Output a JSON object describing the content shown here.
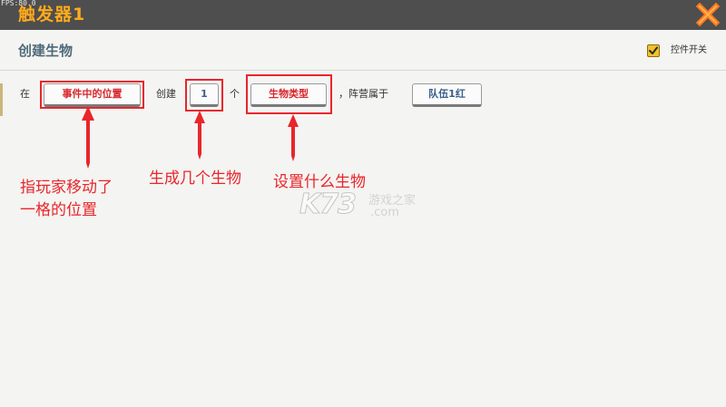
{
  "window": {
    "fps_text": "FPS:80.0",
    "title": "触发器1"
  },
  "panel": {
    "section_title": "创建生物",
    "toggle": {
      "label": "控件开关",
      "checked": true
    }
  },
  "statement": {
    "word_at": "在",
    "location_slot": "事件中的位置",
    "word_create": "创建",
    "count_slot": "1",
    "word_unit": "个",
    "creature_slot": "生物类型",
    "word_faction": "，阵营属于",
    "team_slot": "队伍1红"
  },
  "annotations": {
    "location_note_line1": "指玩家移动了",
    "location_note_line2": "一格的位置",
    "count_note": "生成几个生物",
    "creature_note": "设置什么生物"
  },
  "watermark": {
    "brand": "K73",
    "site_text": "游戏之家",
    "domain_suffix": ".com"
  },
  "colors": {
    "title": "#ffaa1c",
    "close_icon": "#ff7a1c",
    "slot_text_red": "#d8262b",
    "slot_text_blue": "#3a5f8a",
    "annotation_red": "#e8262b",
    "toggle_yellow": "#f2c22a"
  }
}
